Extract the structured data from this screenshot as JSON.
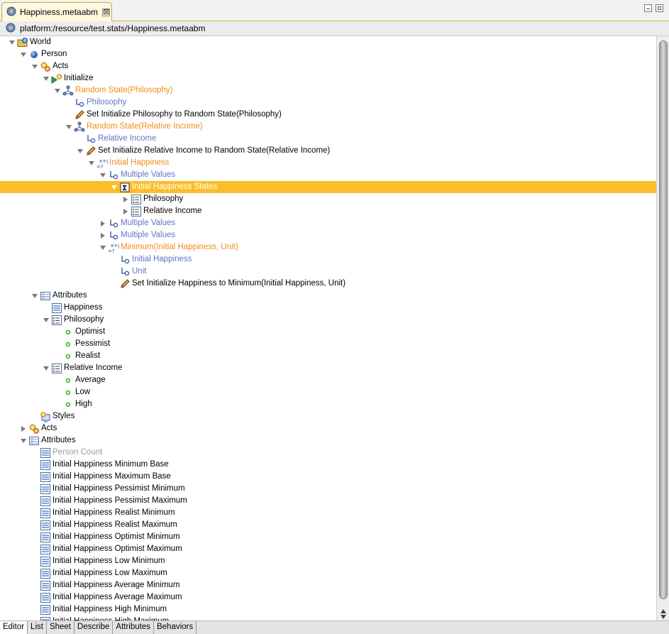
{
  "window": {
    "tab_title": "Happiness.metaabm",
    "tab_close": "⊠"
  },
  "path": "platform:/resource/test.stats/Happiness.metaabm",
  "tree": [
    {
      "label": "World",
      "depth": 0,
      "twisty": "open",
      "icon": "world-folder-icon",
      "color": "black"
    },
    {
      "label": "Person",
      "depth": 1,
      "twisty": "open",
      "icon": "agent-ball-icon",
      "color": "black"
    },
    {
      "label": "Acts",
      "depth": 2,
      "twisty": "open",
      "icon": "acts-gears-icon",
      "color": "black"
    },
    {
      "label": "Initialize",
      "depth": 3,
      "twisty": "open",
      "icon": "initialize-icon",
      "color": "black"
    },
    {
      "label": "Random State(Philosophy)",
      "depth": 4,
      "twisty": "open",
      "icon": "query-icon",
      "color": "orange"
    },
    {
      "label": "Philosophy",
      "depth": 5,
      "twisty": "none",
      "icon": "input-arrow-icon",
      "color": "blue"
    },
    {
      "label": "Set Initialize Philosophy to Random State(Philosophy)",
      "depth": 5,
      "twisty": "none",
      "icon": "pencil-icon",
      "color": "black"
    },
    {
      "label": "Random State(Relative Income)",
      "depth": 5,
      "twisty": "open",
      "icon": "query-icon",
      "color": "orange"
    },
    {
      "label": "Relative Income",
      "depth": 6,
      "twisty": "none",
      "icon": "input-arrow-icon",
      "color": "blue"
    },
    {
      "label": "Set Initialize Relative Income to Random State(Relative Income)",
      "depth": 6,
      "twisty": "open",
      "icon": "pencil-icon",
      "color": "black"
    },
    {
      "label": "Initial Happiness",
      "depth": 7,
      "twisty": "open",
      "icon": "function-xy-icon",
      "color": "orange"
    },
    {
      "label": "Multiple Values",
      "depth": 8,
      "twisty": "open",
      "icon": "input-arrow-icon",
      "color": "blue"
    },
    {
      "label": "Initial Happiness States",
      "depth": 9,
      "twisty": "open",
      "icon": "sigma-icon",
      "color": "black",
      "selected": true
    },
    {
      "label": "Philosophy",
      "depth": 10,
      "twisty": "closed",
      "icon": "state-list-icon",
      "color": "black"
    },
    {
      "label": "Relative Income",
      "depth": 10,
      "twisty": "closed",
      "icon": "state-list-icon",
      "color": "black"
    },
    {
      "label": "Multiple Values",
      "depth": 8,
      "twisty": "closed",
      "icon": "input-arrow-icon",
      "color": "blue"
    },
    {
      "label": "Multiple Values",
      "depth": 8,
      "twisty": "closed",
      "icon": "input-arrow-icon",
      "color": "blue"
    },
    {
      "label": "Minimum(Initial Happiness, Unit)",
      "depth": 8,
      "twisty": "open",
      "icon": "function-xy-icon",
      "color": "orange"
    },
    {
      "label": "Initial Happiness",
      "depth": 9,
      "twisty": "none",
      "icon": "input-arrow-icon",
      "color": "blue"
    },
    {
      "label": "Unit",
      "depth": 9,
      "twisty": "none",
      "icon": "input-arrow-icon",
      "color": "blue"
    },
    {
      "label": "Set Initialize Happiness to Minimum(Initial Happiness, Unit)",
      "depth": 9,
      "twisty": "none",
      "icon": "pencil-icon",
      "color": "black"
    },
    {
      "label": "Attributes",
      "depth": 2,
      "twisty": "open",
      "icon": "attributes-table-icon",
      "color": "black"
    },
    {
      "label": "Happiness",
      "depth": 3,
      "twisty": "none",
      "icon": "attribute-icon",
      "color": "black"
    },
    {
      "label": "Philosophy",
      "depth": 3,
      "twisty": "open",
      "icon": "state-list-icon",
      "color": "black"
    },
    {
      "label": "Optimist",
      "depth": 4,
      "twisty": "none",
      "icon": "state-dot-icon",
      "color": "black"
    },
    {
      "label": "Pessimist",
      "depth": 4,
      "twisty": "none",
      "icon": "state-dot-icon",
      "color": "black"
    },
    {
      "label": "Realist",
      "depth": 4,
      "twisty": "none",
      "icon": "state-dot-icon",
      "color": "black"
    },
    {
      "label": "Relative Income",
      "depth": 3,
      "twisty": "open",
      "icon": "state-list-icon",
      "color": "black"
    },
    {
      "label": "Average",
      "depth": 4,
      "twisty": "none",
      "icon": "state-dot-icon",
      "color": "black"
    },
    {
      "label": "Low",
      "depth": 4,
      "twisty": "none",
      "icon": "state-dot-icon",
      "color": "black"
    },
    {
      "label": "High",
      "depth": 4,
      "twisty": "none",
      "icon": "state-dot-icon",
      "color": "black"
    },
    {
      "label": "Styles",
      "depth": 2,
      "twisty": "none",
      "icon": "styles-icon",
      "color": "black"
    },
    {
      "label": "Acts",
      "depth": 1,
      "twisty": "closed",
      "icon": "acts-gears-icon",
      "color": "black"
    },
    {
      "label": "Attributes",
      "depth": 1,
      "twisty": "open",
      "icon": "attributes-table-icon",
      "color": "black"
    },
    {
      "label": "Person Count",
      "depth": 2,
      "twisty": "none",
      "icon": "attribute-icon",
      "color": "gray"
    },
    {
      "label": "Initial Happiness Minimum Base",
      "depth": 2,
      "twisty": "none",
      "icon": "attribute-icon",
      "color": "black"
    },
    {
      "label": "Initial Happiness Maximum Base",
      "depth": 2,
      "twisty": "none",
      "icon": "attribute-icon",
      "color": "black"
    },
    {
      "label": "Initial Happiness Pessimist Minimum",
      "depth": 2,
      "twisty": "none",
      "icon": "attribute-icon",
      "color": "black"
    },
    {
      "label": "Initial Happiness Pessimist Maximum",
      "depth": 2,
      "twisty": "none",
      "icon": "attribute-icon",
      "color": "black"
    },
    {
      "label": "Initial Happiness Realist Minimum",
      "depth": 2,
      "twisty": "none",
      "icon": "attribute-icon",
      "color": "black"
    },
    {
      "label": "Initial Happiness Realist Maximum",
      "depth": 2,
      "twisty": "none",
      "icon": "attribute-icon",
      "color": "black"
    },
    {
      "label": "Initial Happiness Optimist Minimum",
      "depth": 2,
      "twisty": "none",
      "icon": "attribute-icon",
      "color": "black"
    },
    {
      "label": "Initial Happiness Optimist Maximum",
      "depth": 2,
      "twisty": "none",
      "icon": "attribute-icon",
      "color": "black"
    },
    {
      "label": "Initial Happiness Low Minimum",
      "depth": 2,
      "twisty": "none",
      "icon": "attribute-icon",
      "color": "black"
    },
    {
      "label": "Initial Happiness Low Maximum",
      "depth": 2,
      "twisty": "none",
      "icon": "attribute-icon",
      "color": "black"
    },
    {
      "label": "Initial Happiness Average Minimum",
      "depth": 2,
      "twisty": "none",
      "icon": "attribute-icon",
      "color": "black"
    },
    {
      "label": "Initial Happiness Average Maximum",
      "depth": 2,
      "twisty": "none",
      "icon": "attribute-icon",
      "color": "black"
    },
    {
      "label": "Initial Happiness High Minimum",
      "depth": 2,
      "twisty": "none",
      "icon": "attribute-icon",
      "color": "black"
    },
    {
      "label": "Initial Happiness High Maximum",
      "depth": 2,
      "twisty": "none",
      "icon": "attribute-icon",
      "color": "black"
    }
  ],
  "bottom_tabs": [
    {
      "label": "Editor",
      "active": true
    },
    {
      "label": "List",
      "active": false
    },
    {
      "label": "Sheet",
      "active": false
    },
    {
      "label": "Describe",
      "active": false
    },
    {
      "label": "Attributes",
      "active": false
    },
    {
      "label": "Behaviors",
      "active": false
    }
  ],
  "colors": {
    "selection": "#fbbe2a",
    "orange_text": "#ef8d16",
    "blue_text": "#6372c6",
    "gray_text": "#9a9a9a"
  }
}
